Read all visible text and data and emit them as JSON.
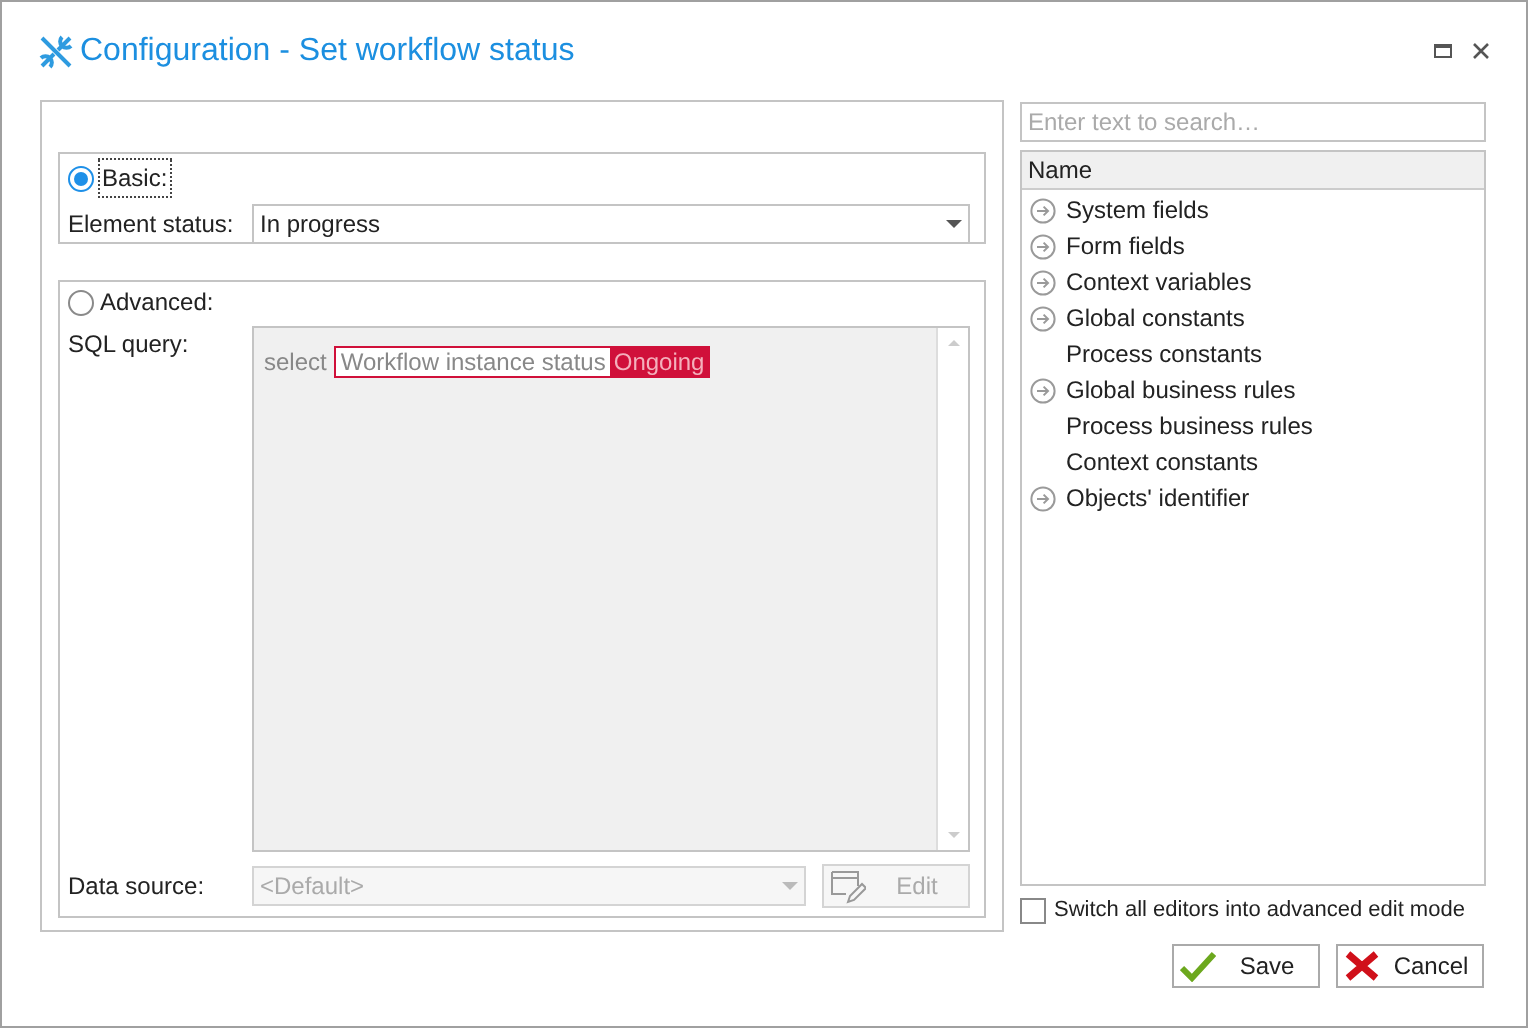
{
  "window": {
    "title": "Configuration - Set workflow status"
  },
  "basic": {
    "label": "Basic:",
    "selected": true,
    "element_status_label": "Element status:",
    "element_status": "In progress"
  },
  "advanced": {
    "label": "Advanced:",
    "selected": false,
    "sql_label": "SQL query:",
    "sql": {
      "keyword": "select",
      "token_name": "Workflow instance status",
      "token_value": "Ongoing"
    },
    "data_source_label": "Data source:",
    "data_source": {
      "value": "<Default>",
      "disabled": true
    },
    "edit_button": {
      "label": "Edit",
      "disabled": true
    }
  },
  "search": {
    "placeholder": "Enter text to search…"
  },
  "tree": {
    "column": "Name",
    "items": [
      {
        "label": "System fields",
        "expandable": true
      },
      {
        "label": "Form fields",
        "expandable": true
      },
      {
        "label": "Context variables",
        "expandable": true
      },
      {
        "label": "Global constants",
        "expandable": true
      },
      {
        "label": "Process constants",
        "expandable": false
      },
      {
        "label": "Global business rules",
        "expandable": true
      },
      {
        "label": "Process business rules",
        "expandable": false
      },
      {
        "label": "Context constants",
        "expandable": false
      },
      {
        "label": "Objects' identifier",
        "expandable": true
      }
    ]
  },
  "switch_advanced": {
    "label": "Switch all editors into advanced edit mode",
    "checked": false
  },
  "buttons": [
    {
      "kind": "save",
      "label": "Save"
    },
    {
      "kind": "cancel",
      "label": "Cancel"
    }
  ]
}
